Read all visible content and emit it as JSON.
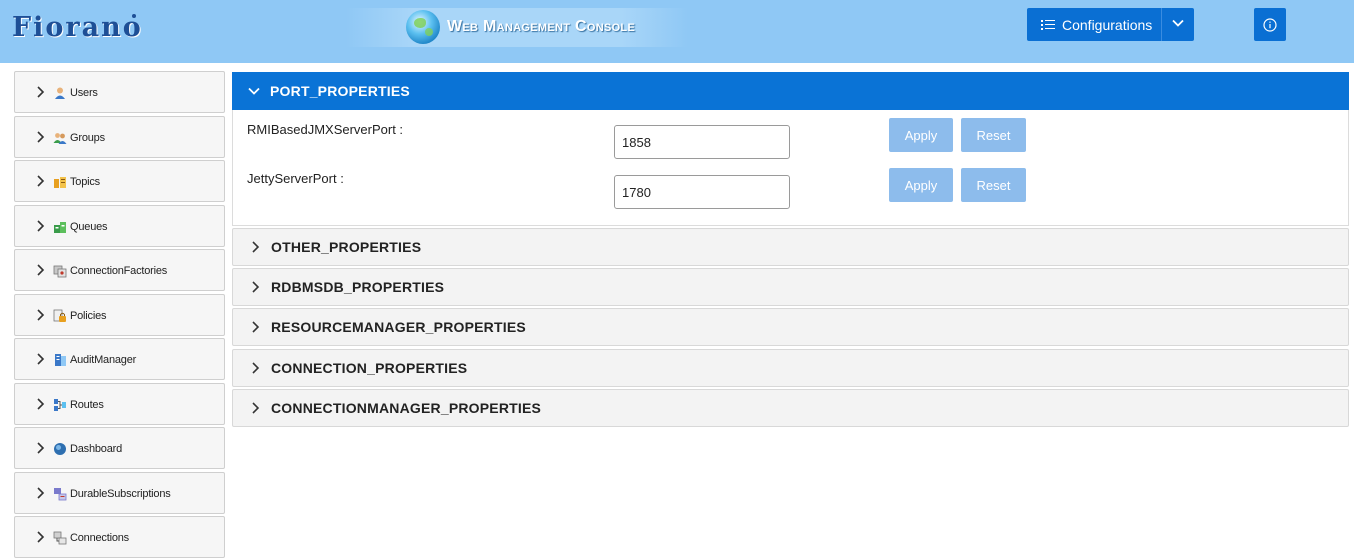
{
  "header": {
    "logo_text": "Fiorano",
    "banner_title": "Web Management Console",
    "configurations_label": "Configurations",
    "info_icon": "info-icon"
  },
  "sidebar": {
    "items": [
      {
        "label": "Users",
        "icon": "user-icon"
      },
      {
        "label": "Groups",
        "icon": "group-icon"
      },
      {
        "label": "Topics",
        "icon": "topics-icon"
      },
      {
        "label": "Queues",
        "icon": "queues-icon"
      },
      {
        "label": "ConnectionFactories",
        "icon": "connection-factories-icon"
      },
      {
        "label": "Policies",
        "icon": "policies-icon"
      },
      {
        "label": "AuditManager",
        "icon": "audit-manager-icon"
      },
      {
        "label": "Routes",
        "icon": "routes-icon"
      },
      {
        "label": "Dashboard",
        "icon": "dashboard-icon"
      },
      {
        "label": "DurableSubscriptions",
        "icon": "durable-subscriptions-icon"
      },
      {
        "label": "Connections",
        "icon": "connections-icon"
      }
    ]
  },
  "panels": {
    "port": {
      "title": "PORT_PROPERTIES",
      "expanded": true,
      "properties": [
        {
          "label": "RMIBasedJMXServerPort :",
          "value": "1858",
          "apply": "Apply",
          "reset": "Reset"
        },
        {
          "label": "JettyServerPort :",
          "value": "1780",
          "apply": "Apply",
          "reset": "Reset"
        }
      ]
    },
    "collapsed": [
      {
        "title": "OTHER_PROPERTIES"
      },
      {
        "title": "RDBMSDB_PROPERTIES"
      },
      {
        "title": "RESOURCEMANAGER_PROPERTIES"
      },
      {
        "title": "CONNECTION_PROPERTIES"
      },
      {
        "title": "CONNECTIONMANAGER_PROPERTIES"
      }
    ]
  },
  "colors": {
    "header_bg": "#8fc8f5",
    "primary_blue": "#0a73d6",
    "button_disabled_blue": "#8dbcec",
    "logo_blue": "#1e4f96"
  }
}
